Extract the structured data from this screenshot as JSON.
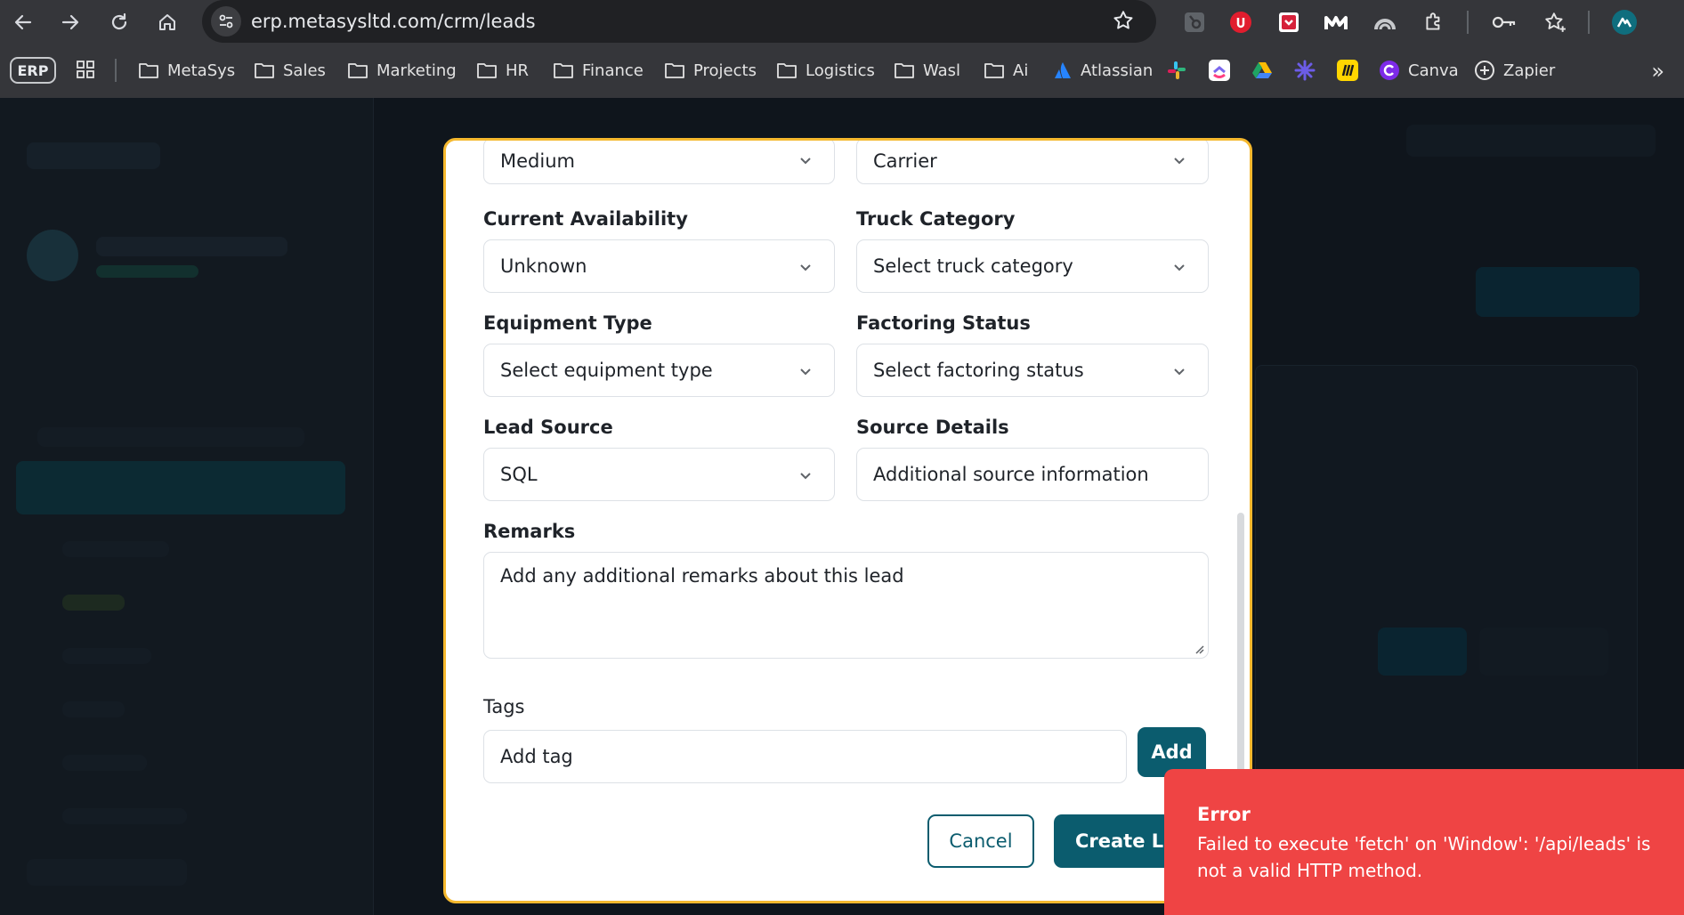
{
  "browser": {
    "url": "erp.metasysltd.com/crm/leads",
    "bookmarks_badge": "ERP",
    "bookmarks": [
      {
        "label": "MetaSys",
        "icon": "folder-icon"
      },
      {
        "label": "Sales",
        "icon": "folder-icon"
      },
      {
        "label": "Marketing",
        "icon": "folder-icon"
      },
      {
        "label": "HR",
        "icon": "folder-icon"
      },
      {
        "label": "Finance",
        "icon": "folder-icon"
      },
      {
        "label": "Projects",
        "icon": "folder-icon"
      },
      {
        "label": "Logistics",
        "icon": "folder-icon"
      },
      {
        "label": "Wasl",
        "icon": "folder-icon"
      },
      {
        "label": "Ai",
        "icon": "folder-icon"
      },
      {
        "label": "Atlassian",
        "icon": "atlassian-icon"
      },
      {
        "label": "Canva",
        "icon": "canva-icon"
      },
      {
        "label": "Zapier",
        "icon": "zapier-icon"
      }
    ]
  },
  "form": {
    "row0": {
      "left_value": "Medium",
      "right_value": "Carrier"
    },
    "current_availability": {
      "label": "Current Availability",
      "value": "Unknown"
    },
    "truck_category": {
      "label": "Truck Category",
      "placeholder": "Select truck category"
    },
    "equipment_type": {
      "label": "Equipment Type",
      "placeholder": "Select equipment type"
    },
    "factoring_status": {
      "label": "Factoring Status",
      "placeholder": "Select factoring status"
    },
    "lead_source": {
      "label": "Lead Source",
      "value": "SQL"
    },
    "source_details": {
      "label": "Source Details",
      "placeholder": "Additional source information"
    },
    "remarks": {
      "label": "Remarks",
      "placeholder": "Add any additional remarks about this lead"
    },
    "tags": {
      "label": "Tags",
      "placeholder": "Add tag",
      "add_label": "Add"
    },
    "cancel_label": "Cancel",
    "create_label": "Create Lead"
  },
  "toast": {
    "title": "Error",
    "message": "Failed to execute 'fetch' on 'Window': '/api/leads' is not a valid HTTP method."
  },
  "colors": {
    "accent": "#0b5c6e",
    "modal_border": "#f5b82e",
    "error": "#ef4444"
  }
}
